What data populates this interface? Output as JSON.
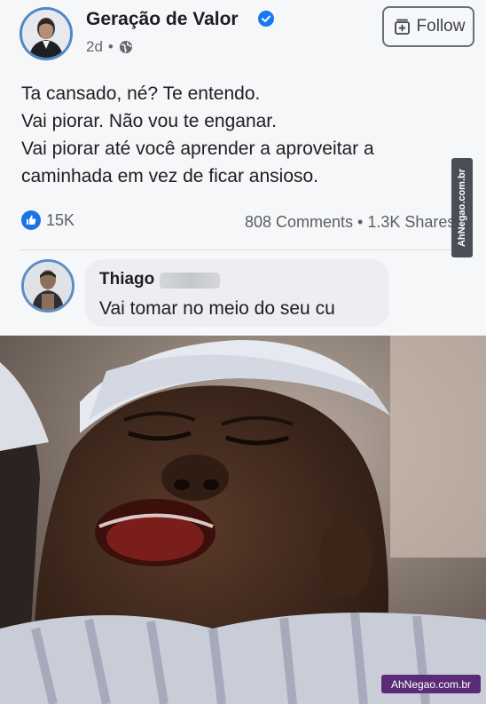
{
  "post": {
    "page_name": "Geração de Valor",
    "time": "2d",
    "audience_icon": "globe-icon",
    "follow_label": "Follow",
    "lines": [
      "Ta cansado, né? Te entendo.",
      "Vai piorar. Não vou te enganar.",
      "Vai piorar até você aprender a aproveitar a",
      "caminhada em vez de ficar ansioso."
    ],
    "reactions_count": "15K",
    "engagement": "808 Comments • 1.3K Shares"
  },
  "comment": {
    "author": "Thiago",
    "text": "Vai tomar no meio do seu cu"
  },
  "watermarks": {
    "side": "AhNegao.com.br",
    "bottom": "AhNegao.com.br"
  },
  "colors": {
    "like_blue": "#1b74e4",
    "verified_blue": "#1877f2",
    "watermark_purple": "#5a2c78"
  }
}
